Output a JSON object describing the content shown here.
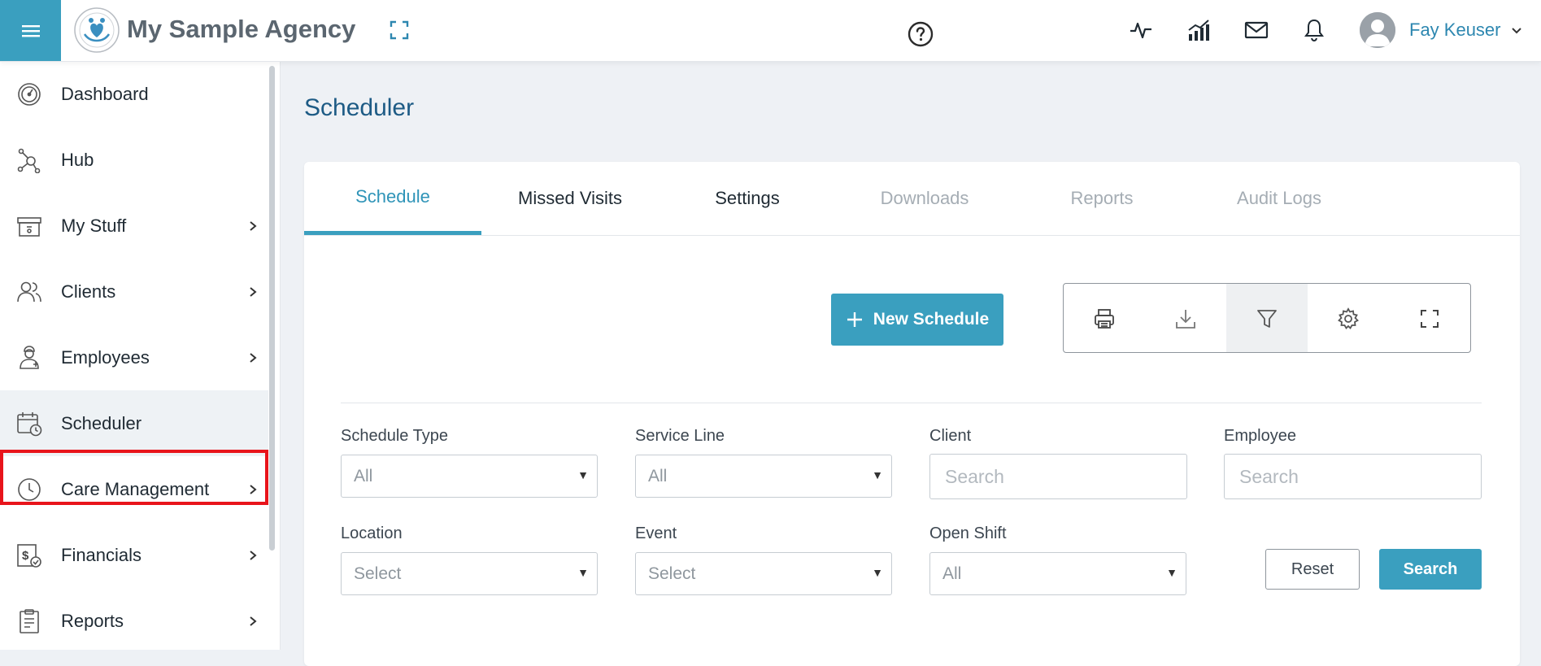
{
  "header": {
    "agency_name": "My Sample Agency",
    "user_name": "Fay Keuser",
    "accent_color": "#3a9fbf"
  },
  "sidebar": {
    "items": [
      {
        "label": "Dashboard",
        "icon": "dashboard-gauge-icon",
        "has_submenu": false
      },
      {
        "label": "Hub",
        "icon": "hub-icon",
        "has_submenu": false
      },
      {
        "label": "My Stuff",
        "icon": "inbox-box-icon",
        "has_submenu": true
      },
      {
        "label": "Clients",
        "icon": "users-icon",
        "has_submenu": true
      },
      {
        "label": "Employees",
        "icon": "employee-icon",
        "has_submenu": true
      },
      {
        "label": "Scheduler",
        "icon": "calendar-clock-icon",
        "has_submenu": false,
        "active": true
      },
      {
        "label": "Care Management",
        "icon": "clock-icon",
        "has_submenu": true
      },
      {
        "label": "Financials",
        "icon": "financials-icon",
        "has_submenu": true
      },
      {
        "label": "Reports",
        "icon": "clipboard-icon",
        "has_submenu": true
      }
    ]
  },
  "main": {
    "page_title": "Scheduler",
    "tabs": [
      {
        "label": "Schedule",
        "state": "active"
      },
      {
        "label": "Missed Visits",
        "state": "normal"
      },
      {
        "label": "Settings",
        "state": "normal"
      },
      {
        "label": "Downloads",
        "state": "muted"
      },
      {
        "label": "Reports",
        "state": "muted"
      },
      {
        "label": "Audit Logs",
        "state": "muted"
      }
    ],
    "new_schedule_label": "New Schedule",
    "toolbar_icons": [
      "print-icon",
      "download-icon",
      "filter-icon",
      "gear-icon",
      "fullscreen-icon"
    ],
    "filters": {
      "schedule_type": {
        "label": "Schedule Type",
        "value": "All"
      },
      "service_line": {
        "label": "Service Line",
        "value": "All"
      },
      "client": {
        "label": "Client",
        "placeholder": "Search"
      },
      "employee": {
        "label": "Employee",
        "placeholder": "Search"
      },
      "location": {
        "label": "Location",
        "value": "Select"
      },
      "event": {
        "label": "Event",
        "value": "Select"
      },
      "open_shift": {
        "label": "Open Shift",
        "value": "All"
      }
    },
    "reset_label": "Reset",
    "search_label": "Search"
  }
}
